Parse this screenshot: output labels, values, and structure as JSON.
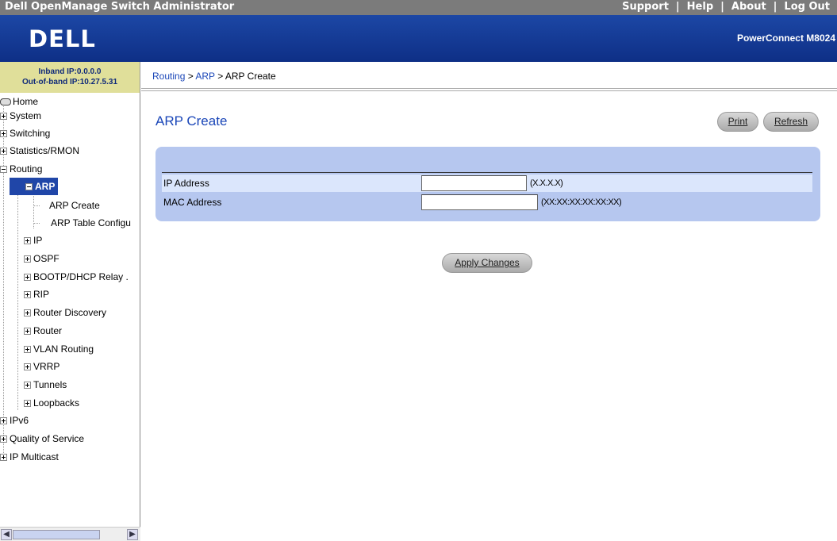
{
  "topbar": {
    "app_title": "Dell OpenManage Switch Administrator",
    "links": [
      "Support",
      "Help",
      "About",
      "Log Out"
    ]
  },
  "header": {
    "logo_text": "DELL",
    "product": "PowerConnect M8024"
  },
  "ipinfo": {
    "inband": "Inband IP:0.0.0.0",
    "outofband": "Out-of-band IP:10.27.5.31"
  },
  "nav": {
    "home": "Home",
    "system": "System",
    "switching": "Switching",
    "statistics": "Statistics/RMON",
    "routing": "Routing",
    "arp": "ARP",
    "arp_create": "ARP Create",
    "arp_table": "ARP Table Configu",
    "ip": "IP",
    "ospf": "OSPF",
    "bootp": "BOOTP/DHCP Relay .",
    "rip": "RIP",
    "router_discovery": "Router Discovery",
    "router": "Router",
    "vlan_routing": "VLAN Routing",
    "vrrp": "VRRP",
    "tunnels": "Tunnels",
    "loopbacks": "Loopbacks",
    "ipv6": "IPv6",
    "qos": "Quality of Service",
    "ip_multicast": "IP Multicast"
  },
  "breadcrumb": {
    "item1": "Routing",
    "sep1": " > ",
    "item2": "ARP",
    "sep2": " > ",
    "current": "ARP Create"
  },
  "main": {
    "title": "ARP Create",
    "print": "Print",
    "refresh": "Refresh",
    "ip_label": "IP Address",
    "ip_value": "",
    "ip_hint": "(X.X.X.X)",
    "mac_label": "MAC Address",
    "mac_value": "",
    "mac_hint": "(XX:XX:XX:XX:XX:XX)",
    "apply": "Apply Changes"
  }
}
